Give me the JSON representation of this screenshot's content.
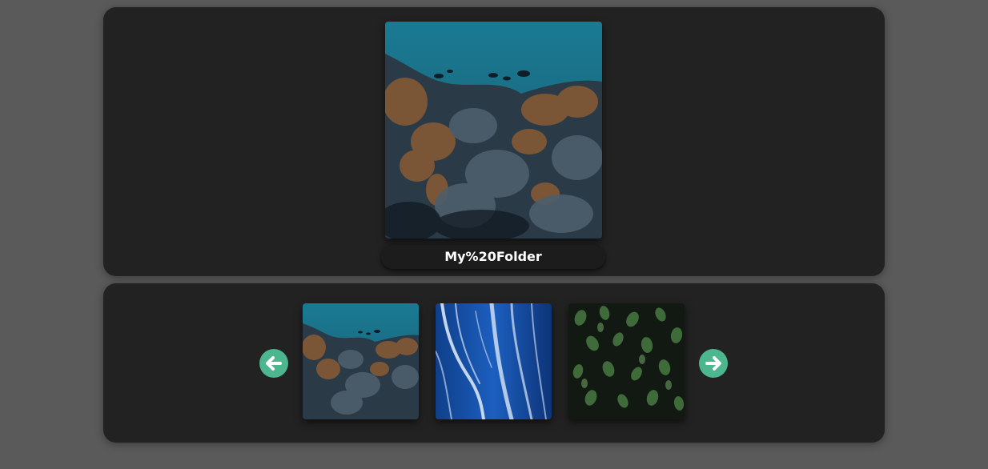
{
  "viewer": {
    "folder_name": "My%20Folder",
    "main_image": "underwater-coral-reef-image"
  },
  "thumbnails": [
    {
      "image": "underwater-coral-reef-image"
    },
    {
      "image": "blue-waterfall-ice-image"
    },
    {
      "image": "green-leaves-foliage-image"
    }
  ],
  "navigation": {
    "prev_icon": "arrow-left-icon",
    "next_icon": "arrow-right-icon"
  },
  "colors": {
    "background": "#5a5a5a",
    "panel": "#222222",
    "label_bg": "#1c1c1c",
    "accent": "#4cb68e",
    "text": "#ffffff"
  }
}
